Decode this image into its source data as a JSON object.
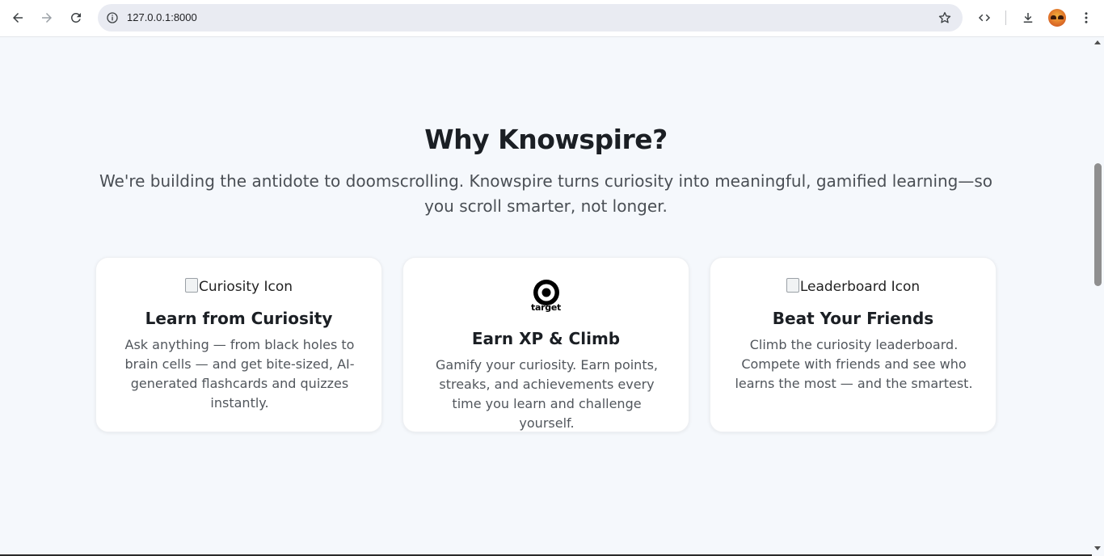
{
  "browser": {
    "url": "127.0.0.1:8000"
  },
  "section": {
    "title": "Why Knowspire?",
    "subtitle": "We're building the antidote to doomscrolling. Knowspire turns curiosity into meaningful, gamified learning—so you scroll smarter, not longer."
  },
  "cards": [
    {
      "image_alt": "Curiosity Icon",
      "title": "Learn from Curiosity",
      "text": "Ask anything — from black holes to brain cells — and get bite-sized, AI-generated flashcards and quizzes instantly."
    },
    {
      "image_logo_word": "target",
      "title": "Earn XP & Climb",
      "text": "Gamify your curiosity. Earn points, streaks, and achievements every time you learn and challenge yourself."
    },
    {
      "image_alt": "Leaderboard Icon",
      "title": "Beat Your Friends",
      "text": "Climb the curiosity leaderboard. Compete with friends and see who learns the most — and the smartest."
    }
  ],
  "icons": {
    "back": "arrow-left-icon",
    "forward": "arrow-right-icon",
    "reload": "reload-icon",
    "info": "info-icon",
    "bookmark": "star-icon",
    "devtools": "code-icon",
    "download": "download-icon",
    "menu": "kebab-menu-icon"
  },
  "colors": {
    "page_background": "#f5f8fc",
    "card_background": "#ffffff",
    "heading_text": "#1b1f24",
    "body_text": "#51565c"
  }
}
